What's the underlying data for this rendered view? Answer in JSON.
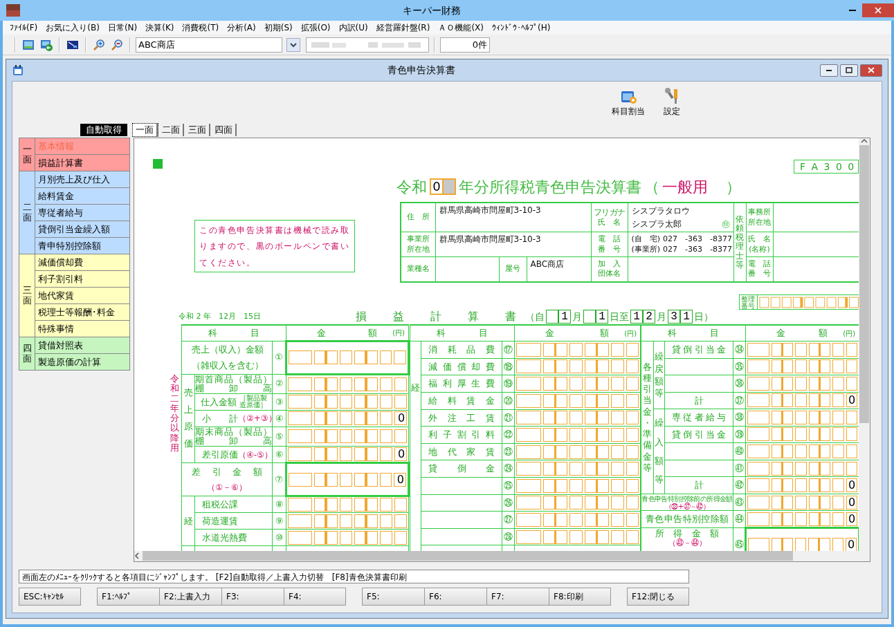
{
  "app_title": "キーパー財務",
  "menu": [
    "ﾌｧｲﾙ(F)",
    "お気に入り(B)",
    "日常(N)",
    "決算(K)",
    "消費税(T)",
    "分析(A)",
    "初期(S)",
    "拡張(O)",
    "内訳(U)",
    "経営羅針盤(R)",
    "ＡＯ機能(X)",
    "ｳｨﾝﾄﾞｳ･ﾍﾙﾌﾟ(H)"
  ],
  "toolbar": {
    "company": "ABC商店",
    "count": "0件"
  },
  "child_window": {
    "title": "青色申告決算書"
  },
  "tools": [
    {
      "label": "科目割当",
      "kind": "assign"
    },
    {
      "label": "設定",
      "kind": "settings"
    }
  ],
  "auto_fetch": "自動取得",
  "tabs": [
    {
      "label": "一面",
      "selected": true
    },
    {
      "label": "二面",
      "selected": false
    },
    {
      "label": "三面",
      "selected": false
    },
    {
      "label": "四面",
      "selected": false
    }
  ],
  "sidebar": [
    {
      "label": "一面",
      "color": "#ff9c9c",
      "items": [
        {
          "label": "基本情報",
          "selected": true
        },
        {
          "label": "損益計算書",
          "selected": false
        }
      ]
    },
    {
      "label": "二面",
      "color": "#bcdcff",
      "items": [
        {
          "label": "月別売上及び仕入",
          "selected": false
        },
        {
          "label": "給料賃金",
          "selected": false
        },
        {
          "label": "専従者給与",
          "selected": false
        },
        {
          "label": "貸倒引当金繰入額",
          "selected": false
        },
        {
          "label": "青申特別控除額",
          "selected": false
        }
      ]
    },
    {
      "label": "三面",
      "color": "#ffffbf",
      "items": [
        {
          "label": "減価償却費",
          "selected": false
        },
        {
          "label": "利子割引料",
          "selected": false
        },
        {
          "label": "地代家賃",
          "selected": false
        },
        {
          "label": "税理士等報酬･料金",
          "selected": false
        },
        {
          "label": "特殊事情",
          "selected": false
        }
      ]
    },
    {
      "label": "四面",
      "color": "#c6f5c0",
      "items": [
        {
          "label": "貸借対照表",
          "selected": false
        },
        {
          "label": "製造原価の計算",
          "selected": false
        }
      ]
    }
  ],
  "form": {
    "form_code": "F A 3 0 0",
    "title": {
      "era": "令和",
      "year": "0",
      "year_field_focused": true,
      "main": "年分所得税青色申告決算書",
      "open": "（",
      "variant": "一般用",
      "close": "　）"
    },
    "notice": "この青色申告決算書は機械で読み取りますので、黒のボールペンで書いてください。",
    "info": {
      "address": {
        "label": [
          "住　所"
        ],
        "value": "群馬県高崎市問屋町3-10-3"
      },
      "name": {
        "ruby_label": "フリガナ",
        "label": "氏　名",
        "furigana": "シスプラタロウ",
        "value": "シスプラ太郎",
        "seal": "㊞"
      },
      "office": {
        "label": [
          "事業所",
          "所在地"
        ],
        "value": "群馬県高崎市問屋町3-10-3"
      },
      "phone": {
        "label": [
          "電　話",
          "番　号"
        ],
        "numbers": [
          {
            "type": "(自　宅)",
            "number": "027　-363　-8377"
          },
          {
            "type": "(事業所)",
            "number": "027　-363　-8377"
          }
        ]
      },
      "business": {
        "label": [
          "業種名"
        ]
      },
      "trade_name": {
        "label": [
          "屋号"
        ],
        "value": "ABC商店"
      },
      "association": {
        "label": [
          "加　入",
          "団体名"
        ]
      },
      "accountant": {
        "label": "依頼税理士等",
        "office_label": [
          "事務所",
          "所在地"
        ],
        "name_label": [
          "氏　名",
          "(名称)"
        ],
        "phone_label": [
          "電　話",
          "番　号"
        ]
      }
    },
    "filing_number_label": "整理番号",
    "date": "令和 2 年　12月　15日",
    "statement": {
      "title": "損　益　計　算　書",
      "open": "（自",
      "from_month": "1",
      "month_sep": "月",
      "from_day": "1",
      "to_sep": "日至",
      "to_month": "12",
      "to_month_sep": "月",
      "to_day": "31",
      "close": "日）"
    },
    "side_note": "令和二年分以降用",
    "left": {
      "item_header": "科　目",
      "amount_header": "金　額",
      "unit": "(円)",
      "rows": [
        {
          "kind": "single",
          "no": "①",
          "label": "売上（収入）金額",
          "sub": "（雑収入を含む）",
          "sub_formula": false
        },
        {
          "kind": "group",
          "group": "売上原価",
          "rows": [
            {
              "no": "②",
              "lines": [
                "期首商品（製品）",
                "棚　　卸　　高"
              ]
            },
            {
              "no": "③",
              "label": "仕入金額",
              "note": "［製品製造原価］"
            },
            {
              "no": "④",
              "label": "小　　計",
              "formula": "（②+③）",
              "amount": "0"
            },
            {
              "no": "⑤",
              "lines": [
                "期末商品（製品）",
                "棚　　卸　　高"
              ]
            },
            {
              "no": "⑥",
              "label": "差引原価",
              "formula": "（④-⑤）",
              "amount": "0"
            }
          ]
        },
        {
          "kind": "single",
          "no": "⑦",
          "label": "差　引　金　額",
          "sub": "（①－⑥）",
          "sub_formula": true,
          "amount": "0"
        },
        {
          "kind": "group",
          "group": "経",
          "rows": [
            {
              "no": "⑧",
              "label": "租税公課"
            },
            {
              "no": "⑨",
              "label": "荷造運賃"
            },
            {
              "no": "⑩",
              "label": "水道光熱費"
            }
          ]
        }
      ]
    },
    "middle": {
      "item_header": "科　目",
      "amount_header": "金　額",
      "unit": "(円)",
      "group": "経",
      "rows": [
        {
          "no": "⑰",
          "label": "消耗品費"
        },
        {
          "no": "⑱",
          "label": "減価償却費"
        },
        {
          "no": "⑲",
          "label": "福利厚生費"
        },
        {
          "no": "⑳",
          "label": "給料賃金"
        },
        {
          "no": "㉑",
          "label": "外注工賃"
        },
        {
          "no": "㉒",
          "label": "利子割引料"
        },
        {
          "no": "㉓",
          "label": "地代家賃"
        },
        {
          "no": "㉔",
          "label": "貸倒金"
        },
        {
          "no": "㉕"
        },
        {
          "no": "㉖"
        },
        {
          "no": "㉗"
        },
        {
          "no": "㉘"
        }
      ]
    },
    "right": {
      "item_header": "科　目",
      "amount_header": "金　額",
      "unit": "(円)",
      "group": "各種引当金・準備金等",
      "subgroups": [
        {
          "label": "繰戻額等",
          "rows": [
            {
              "no": "㉞",
              "label": "貸倒引当金"
            },
            {
              "no": "㉟"
            },
            {
              "no": "㊱"
            },
            {
              "no": "㊲",
              "label": "計",
              "kind": "sum",
              "amount": "0"
            }
          ]
        },
        {
          "label": "繰入額等",
          "rows": [
            {
              "no": "㊳",
              "label": "専従者給与"
            },
            {
              "no": "㊴",
              "label": "貸倒引当金"
            },
            {
              "no": "㊵"
            },
            {
              "no": "㊶"
            },
            {
              "no": "㊷",
              "label": "計",
              "kind": "sum",
              "amount": "0"
            }
          ]
        }
      ],
      "totals": [
        {
          "no": "㊸",
          "label": "青色申告特別控除前の所得金額",
          "formula": "（㉝+㊲－㊷）",
          "amount": "0"
        },
        {
          "no": "㊹",
          "label": "青色申告特別控除額",
          "amount": "0"
        },
        {
          "no": "㊺",
          "label": "所得金額",
          "formula": "（㊸－㊹）",
          "amount": "0",
          "kind": "total"
        }
      ]
    }
  },
  "status_text": "画面左のﾒﾆｭｰをｸﾘｯｸすると各項目にｼﾞｬﾝﾌﾟします。 [F2]自動取得／上書入力切替　[F8]青色決算書印刷",
  "function_key_groups": [
    [
      "ESC:ｷｬﾝｾﾙ"
    ],
    [
      "F1:ﾍﾙﾌﾟ",
      "F2:上書入力",
      "F3:",
      "F4:"
    ],
    [
      "F5:",
      "F6:",
      "F7:",
      "F8:印刷"
    ],
    [
      "F12:閉じる"
    ]
  ]
}
